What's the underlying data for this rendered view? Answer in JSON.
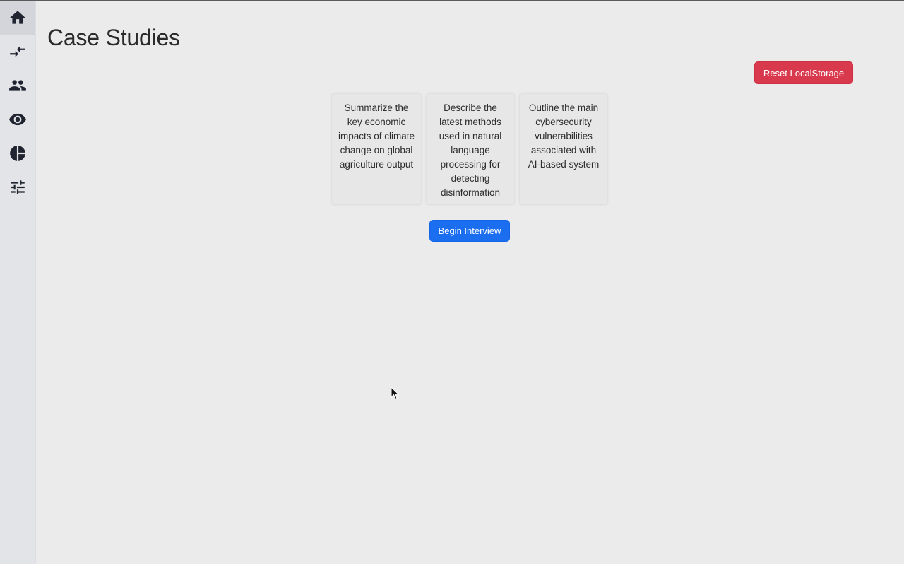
{
  "sidebar": {
    "items": [
      {
        "icon": "home-icon",
        "active": true
      },
      {
        "icon": "compare-arrows-icon",
        "active": false
      },
      {
        "icon": "people-icon",
        "active": false
      },
      {
        "icon": "eye-icon",
        "active": false
      },
      {
        "icon": "pie-chart-icon",
        "active": false
      },
      {
        "icon": "tune-icon",
        "active": false
      }
    ]
  },
  "header": {
    "title": "Case Studies"
  },
  "actions": {
    "reset_label": "Reset LocalStorage",
    "begin_label": "Begin Interview"
  },
  "cards": [
    {
      "text": "Summarize the key economic impacts of climate change on global agriculture output"
    },
    {
      "text": "Describe the latest methods used in natural language processing for detecting disinformation"
    },
    {
      "text": "Outline the main cybersecurity vulnerabilities associated with AI-based system"
    }
  ],
  "colors": {
    "background": "#ebebeb",
    "sidebar": "#e3e4e8",
    "danger": "#d9394c",
    "primary": "#1b6ef0"
  }
}
